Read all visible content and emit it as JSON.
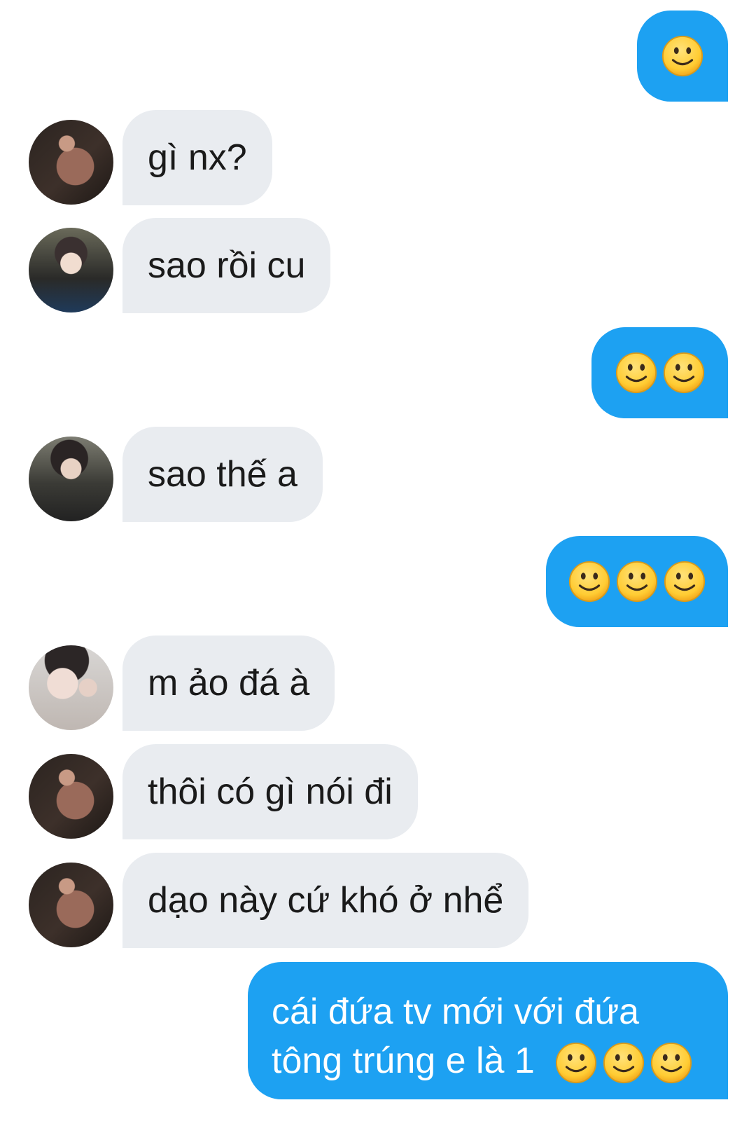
{
  "messages": [
    {
      "direction": "out",
      "text": "",
      "emoji": "slightly-smiling-face",
      "emoji_count": 1
    },
    {
      "direction": "in",
      "avatar": "avatar-a",
      "text": "gì nx?"
    },
    {
      "direction": "in",
      "avatar": "avatar-b",
      "text": "sao rồi cu"
    },
    {
      "direction": "out",
      "text": "",
      "emoji": "slightly-smiling-face",
      "emoji_count": 2
    },
    {
      "direction": "in",
      "avatar": "avatar-c",
      "text": "sao thế a"
    },
    {
      "direction": "out",
      "text": "",
      "emoji": "slightly-smiling-face",
      "emoji_count": 3
    },
    {
      "direction": "in",
      "avatar": "avatar-d",
      "text": "m ảo đá à"
    },
    {
      "direction": "in",
      "avatar": "avatar-a",
      "text": "thôi có gì nói đi"
    },
    {
      "direction": "in",
      "avatar": "avatar-a",
      "text": "dạo này cứ khó ở nhể"
    },
    {
      "direction": "out",
      "text_line1": "cái đứa tv mới với đứa",
      "text_line2": "tông trúng e là 1",
      "emoji": "slightly-smiling-face",
      "emoji_count": 3
    }
  ],
  "colors": {
    "outgoing_bubble": "#1da1f2",
    "incoming_bubble": "#e9ecf0",
    "incoming_text": "#1a1a1a",
    "outgoing_text": "#ffffff",
    "emoji_face": "#ffcc33"
  }
}
